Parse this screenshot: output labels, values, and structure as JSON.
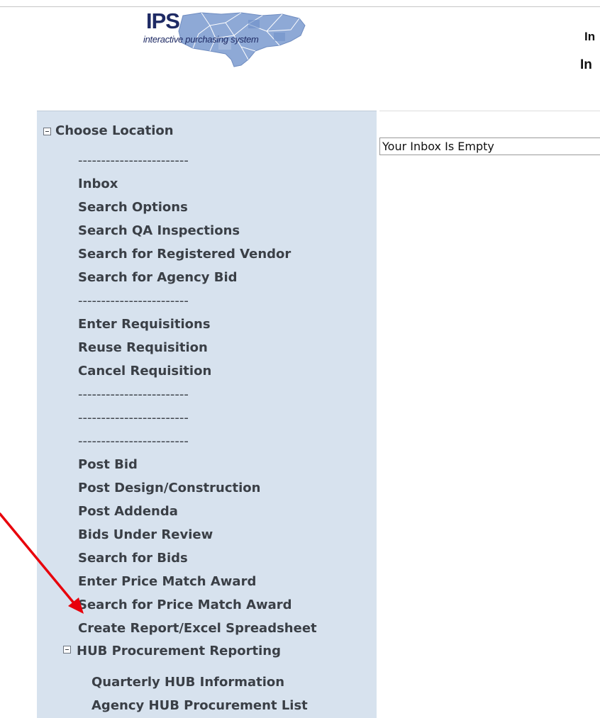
{
  "logo": {
    "wordmark": "IPS",
    "tagline": "interactive purchasing system"
  },
  "header": {
    "line1": "In",
    "line2": "In"
  },
  "inbox": {
    "message": "Your Inbox Is Empty"
  },
  "menu": {
    "root_label": "Choose Location",
    "separator": "------------------------",
    "items": {
      "inbox": "Inbox",
      "search_options": "Search Options",
      "search_qa_inspections": "Search QA Inspections",
      "search_registered_vendor": "Search for Registered Vendor",
      "search_agency_bid": "Search for Agency Bid",
      "enter_requisitions": "Enter Requisitions",
      "reuse_requisition": "Reuse Requisition",
      "cancel_requisition": "Cancel Requisition",
      "post_bid": "Post Bid",
      "post_design_construction": "Post Design/Construction",
      "post_addenda": "Post Addenda",
      "bids_under_review": "Bids Under Review",
      "search_for_bids": "Search for Bids",
      "enter_price_match_award": "Enter Price Match Award",
      "search_price_match_award": "Search for Price Match Award",
      "create_report": "Create Report/Excel Spreadsheet"
    },
    "hub": {
      "label": "HUB Procurement Reporting",
      "items": {
        "quarterly": "Quarterly HUB Information",
        "agency_list": "Agency HUB Procurement List"
      }
    }
  },
  "annotation": {
    "arrow_color": "#e8000b"
  }
}
